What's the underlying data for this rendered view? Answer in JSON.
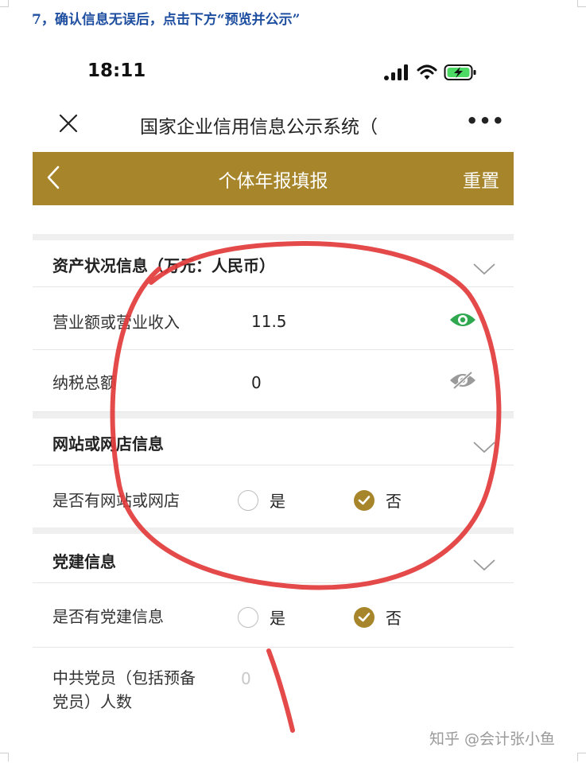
{
  "doc_heading": "7，确认信息无误后，点击下方“预览并公示”",
  "status_bar": {
    "time": "18:11"
  },
  "browser": {
    "title": "国家企业信用信息公示系统（",
    "more_label": "•••"
  },
  "app_header": {
    "title": "个体年报填报",
    "reset_label": "重置"
  },
  "sections": [
    {
      "title": "资产状况信息（万元：人民币）",
      "rows": [
        {
          "label": "营业额或营业收入",
          "value": "11.5",
          "visibility": "public"
        },
        {
          "label": "纳税总额",
          "value": "0",
          "visibility": "hidden"
        }
      ]
    },
    {
      "title": "网站或网店信息",
      "rows": [
        {
          "label": "是否有网站或网店",
          "options": [
            "是",
            "否"
          ],
          "selected": "否"
        }
      ]
    },
    {
      "title": "党建信息",
      "rows": [
        {
          "label": "是否有党建信息",
          "options": [
            "是",
            "否"
          ],
          "selected": "否"
        },
        {
          "label_line1": "中共党员（包括预备",
          "label_line2": "党员）人数",
          "placeholder": "0"
        }
      ]
    }
  ],
  "watermark": "知乎 @会计张小鱼",
  "colors": {
    "header_gold": "#a7852a",
    "heading_blue": "#1f4fa0",
    "eye_green": "#2fa84f",
    "annotation_red": "#e33b3b"
  }
}
